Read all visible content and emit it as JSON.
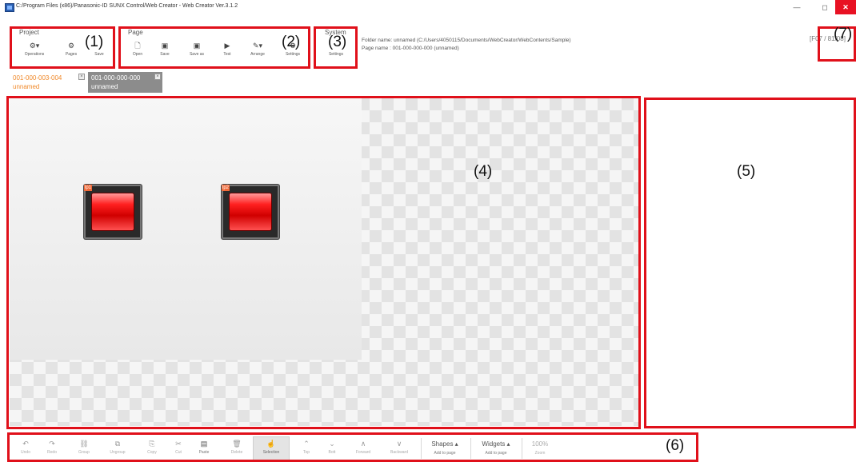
{
  "window": {
    "title": "C:/Program Files (x86)/Panasonic-ID SUNX Control/Web Creator - Web Creator Ver.3.1.2",
    "minimize": "—",
    "maximize": "◻",
    "close": "✕"
  },
  "ribbon": {
    "project": {
      "title": "Project",
      "buttons": [
        {
          "label": "Operations",
          "icon": "gear-dropdown-icon"
        },
        {
          "label": "Pages",
          "icon": "gear-icon"
        },
        {
          "label": "Save",
          "icon": "save-icon"
        }
      ]
    },
    "page": {
      "title": "Page",
      "buttons": [
        {
          "label": "Open",
          "icon": "file-icon"
        },
        {
          "label": "Save",
          "icon": "save-icon"
        },
        {
          "label": "Save as",
          "icon": "save-as-icon"
        },
        {
          "label": "Test",
          "icon": "play-icon"
        },
        {
          "label": "Arrange",
          "icon": "arrange-icon"
        },
        {
          "label": "Settings",
          "icon": "settings-icon"
        }
      ]
    },
    "system": {
      "title": "System",
      "buttons": [
        {
          "label": "Settings",
          "icon": "settings-icon"
        }
      ]
    }
  },
  "info": {
    "folder": "Folder name: unnamed (C:/Users/4050115/Documents/WebCreator/WebContents/Sample)",
    "page": "Page name : 001-000-000-000 (unnamed)",
    "page_indicator": "[F07 / 81/08]"
  },
  "tabs": [
    {
      "id": "001-000-003-004",
      "name": "unnamed",
      "state": "inactive"
    },
    {
      "id": "001-000-000-000",
      "name": "unnamed",
      "state": "active"
    }
  ],
  "canvas": {
    "lamps": [
      {
        "tag": "lp1"
      },
      {
        "tag": "lp2"
      }
    ]
  },
  "bottom_toolbar": {
    "buttons": [
      {
        "label": "Undo",
        "icon": "undo-icon"
      },
      {
        "label": "Redo",
        "icon": "redo-icon"
      },
      {
        "label": "Group",
        "icon": "group-icon"
      },
      {
        "label": "Ungroup",
        "icon": "ungroup-icon"
      },
      {
        "label": "Copy",
        "icon": "copy-icon"
      },
      {
        "label": "Cut",
        "icon": "cut-icon"
      },
      {
        "label": "Paste",
        "icon": "paste-icon"
      },
      {
        "label": "Delete",
        "icon": "delete-icon"
      },
      {
        "label": "Selection",
        "icon": "pointer-icon"
      },
      {
        "label": "Top",
        "icon": "top-icon"
      },
      {
        "label": "Bott",
        "icon": "bottom-icon"
      },
      {
        "label": "Forward",
        "icon": "forward-icon"
      },
      {
        "label": "Backward",
        "icon": "backward-icon"
      }
    ],
    "shapes": {
      "label": "Shapes ▴",
      "sub": "Add to page"
    },
    "widgets": {
      "label": "Widgets ▴",
      "sub": "Add to page"
    },
    "zoom": {
      "value": "100%",
      "label": "Zoom"
    }
  },
  "callouts": [
    "(1)",
    "(2)",
    "(3)",
    "(4)",
    "(5)",
    "(6)",
    "(7)"
  ],
  "colors": {
    "callout_border": "#e0101a",
    "tab_inactive_text": "#f0892a",
    "tab_active_bg": "#8c8c8c",
    "lamp_red": "#ff2020",
    "close_button": "#e81123"
  }
}
